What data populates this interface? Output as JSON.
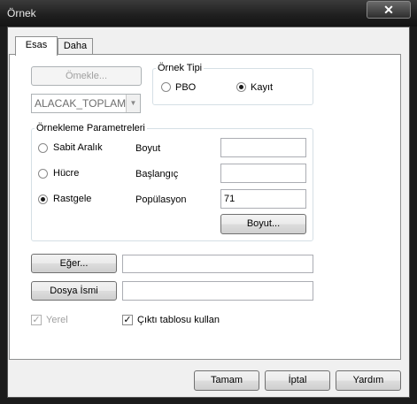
{
  "window": {
    "title": "Örnek",
    "close_glyph": "✕"
  },
  "tabs": [
    {
      "label": "Esas"
    },
    {
      "label": "Daha"
    }
  ],
  "left": {
    "sample_button": "Ömekle...",
    "column_select": "ALACAK_TOPLAMI"
  },
  "sample_type": {
    "legend": "Örnek Tipi",
    "options": [
      {
        "label": "PBO",
        "checked": false
      },
      {
        "label": "Kayıt",
        "checked": true
      }
    ]
  },
  "params": {
    "legend": "Örnekleme Parametreleri",
    "radios": [
      {
        "label": "Sabit Aralık",
        "checked": false
      },
      {
        "label": "Hücre",
        "checked": false
      },
      {
        "label": "Rastgele",
        "checked": true
      }
    ],
    "fields": [
      {
        "label": "Boyut",
        "value": ""
      },
      {
        "label": "Başlangıç",
        "value": ""
      },
      {
        "label": "Popülasyon",
        "value": "71"
      }
    ],
    "size_button": "Boyut..."
  },
  "condition": {
    "button": "Eğer...",
    "value": ""
  },
  "file": {
    "button": "Dosya İsmi",
    "value": ""
  },
  "options": {
    "local_label": "Yerel",
    "local_checked": true,
    "output_table_label": "Çıktı tablosu kullan",
    "output_table_checked": true
  },
  "footer": {
    "ok": "Tamam",
    "cancel": "İptal",
    "help": "Yardım"
  }
}
